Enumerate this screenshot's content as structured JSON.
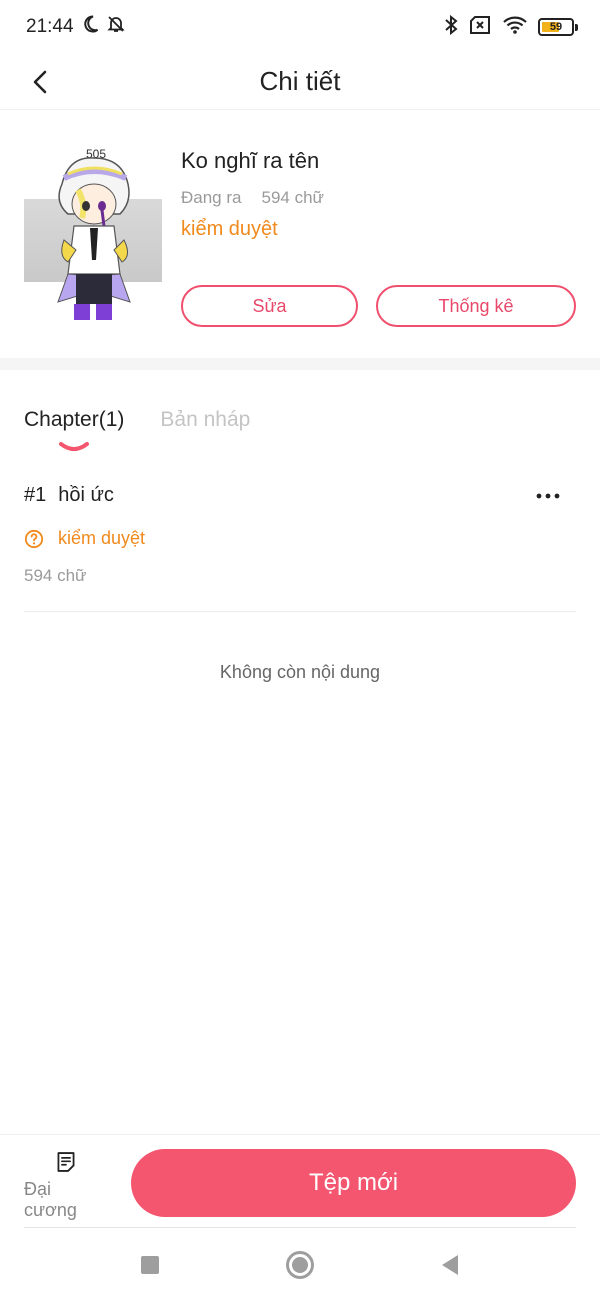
{
  "status_bar": {
    "time": "21:44",
    "battery_level": "59",
    "battery_fraction": 0.59,
    "icons": [
      "moon-icon",
      "bell-off-icon",
      "bluetooth-icon",
      "sim-off-icon",
      "wifi-icon",
      "battery-icon"
    ]
  },
  "header": {
    "title": "Chi tiết",
    "back_icon": "chevron-left-icon"
  },
  "story": {
    "title": "Ko nghĩ ra tên",
    "state": "Đang ra",
    "word_count": "594 chữ",
    "review_status": "kiểm duyệt",
    "edit_label": "Sửa",
    "stats_label": "Thống kê",
    "cover_number": "505"
  },
  "tabs": [
    {
      "label": "Chapter(1)",
      "active": true
    },
    {
      "label": "Bản nháp",
      "active": false
    }
  ],
  "chapters": [
    {
      "number": "#1",
      "title": "hồi ức",
      "status": "kiểm duyệt",
      "word_count": "594 chữ",
      "status_icon": "question-circle-icon",
      "more_icon": "more-horizontal-icon"
    }
  ],
  "empty_text": "Không còn nội dung",
  "bottom": {
    "outline_label": "Đại cương",
    "outline_icon": "document-list-icon",
    "new_file_label": "Tệp mới"
  },
  "nav": [
    "square-icon",
    "circle-icon",
    "triangle-back-icon"
  ],
  "colors": {
    "accent": "#f4566f",
    "status_orange": "#f08a1c",
    "muted": "#9a9a9a"
  }
}
